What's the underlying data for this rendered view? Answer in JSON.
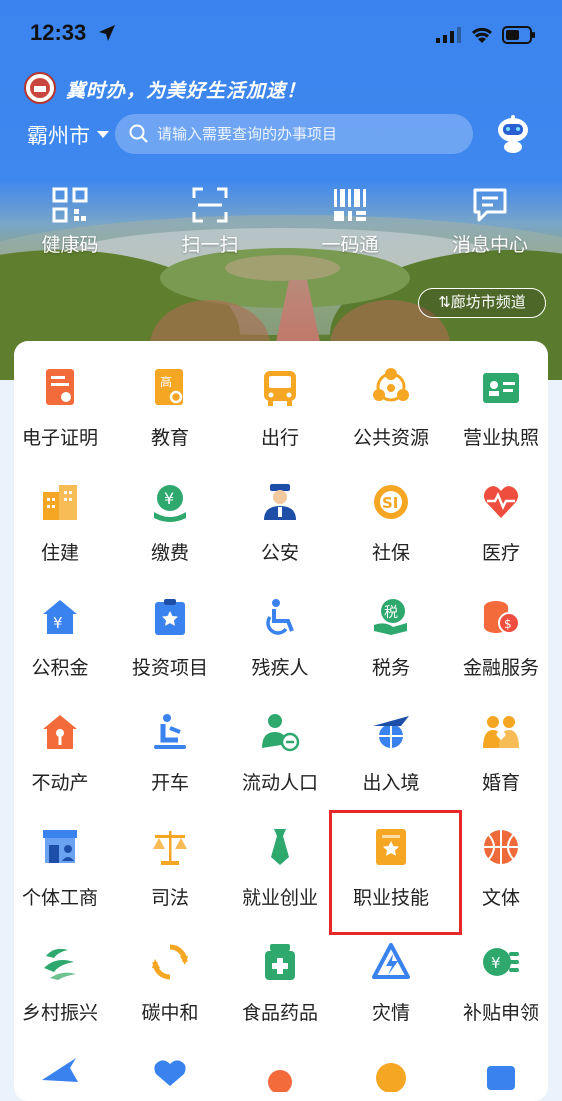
{
  "status_bar": {
    "time": "12:33"
  },
  "header": {
    "slogan": "冀时办，为美好生活加速！",
    "city": "霸州市",
    "search_placeholder": "请输入需要查询的办事项目",
    "channel_label": "廊坊市频道"
  },
  "quick_actions": [
    {
      "label": "健康码",
      "icon": "health-code-icon"
    },
    {
      "label": "扫一扫",
      "icon": "scan-icon"
    },
    {
      "label": "一码通",
      "icon": "barcode-icon"
    },
    {
      "label": "消息中心",
      "icon": "message-icon"
    }
  ],
  "services": [
    {
      "label": "电子证明",
      "icon": "certificate-icon"
    },
    {
      "label": "教育",
      "icon": "education-icon"
    },
    {
      "label": "出行",
      "icon": "bus-icon"
    },
    {
      "label": "公共资源",
      "icon": "network-icon"
    },
    {
      "label": "营业执照",
      "icon": "license-icon"
    },
    {
      "label": "住建",
      "icon": "building-icon"
    },
    {
      "label": "缴费",
      "icon": "payment-icon"
    },
    {
      "label": "公安",
      "icon": "police-icon"
    },
    {
      "label": "社保",
      "icon": "social-security-icon"
    },
    {
      "label": "医疗",
      "icon": "heart-icon"
    },
    {
      "label": "公积金",
      "icon": "housing-fund-icon"
    },
    {
      "label": "投资项目",
      "icon": "clipboard-icon"
    },
    {
      "label": "残疾人",
      "icon": "wheelchair-icon"
    },
    {
      "label": "税务",
      "icon": "tax-icon"
    },
    {
      "label": "金融服务",
      "icon": "coins-icon"
    },
    {
      "label": "不动产",
      "icon": "house-key-icon"
    },
    {
      "label": "开车",
      "icon": "driver-icon"
    },
    {
      "label": "流动人口",
      "icon": "person-transfer-icon"
    },
    {
      "label": "出入境",
      "icon": "plane-globe-icon"
    },
    {
      "label": "婚育",
      "icon": "family-icon"
    },
    {
      "label": "个体工商",
      "icon": "shop-icon"
    },
    {
      "label": "司法",
      "icon": "scales-icon"
    },
    {
      "label": "就业创业",
      "icon": "tie-icon"
    },
    {
      "label": "职业技能",
      "icon": "skill-card-icon"
    },
    {
      "label": "文体",
      "icon": "basketball-icon"
    },
    {
      "label": "乡村振兴",
      "icon": "rural-icon"
    },
    {
      "label": "碳中和",
      "icon": "recycle-icon"
    },
    {
      "label": "食品药品",
      "icon": "medicine-icon"
    },
    {
      "label": "灾情",
      "icon": "disaster-icon"
    },
    {
      "label": "补贴申领",
      "icon": "subsidy-icon"
    }
  ],
  "colors": {
    "header_blue": "#3b83ee",
    "highlight_red": "#e62828"
  }
}
